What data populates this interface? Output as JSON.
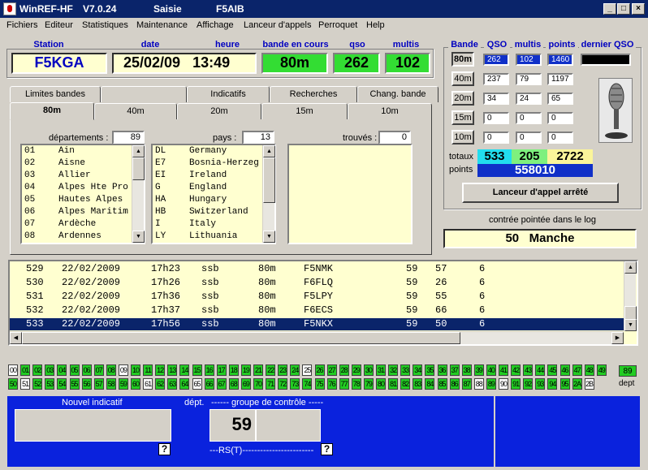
{
  "titlebar": {
    "app": "WinREF-HF",
    "version": "V7.0.24",
    "mode": "Saisie",
    "callsign": "F5AIB"
  },
  "menu": [
    "Fichiers",
    "Editeur",
    "Statistiques",
    "Maintenance",
    "Affichage",
    "Lanceur d'appels",
    "Perroquet",
    "Help"
  ],
  "header": {
    "station_label": "Station",
    "date_label": "date",
    "heure_label": "heure",
    "band_label": "bande en cours",
    "qso_label": "qso",
    "multis_label": "multis",
    "station": "F5KGA",
    "date": "25/02/09",
    "heure": "13:49",
    "band": "80m",
    "qso": "262",
    "multis": "102"
  },
  "bandtable": {
    "headers": [
      "Bande",
      "QSO",
      "multis",
      "points",
      "dernier QSO"
    ],
    "rows": [
      {
        "band": "80m",
        "qso": "262",
        "multis": "102",
        "points": "1460",
        "active": true
      },
      {
        "band": "40m",
        "qso": "237",
        "multis": "79",
        "points": "1197"
      },
      {
        "band": "20m",
        "qso": "34",
        "multis": "24",
        "points": "65"
      },
      {
        "band": "15m",
        "qso": "0",
        "multis": "0",
        "points": "0"
      },
      {
        "band": "10m",
        "qso": "0",
        "multis": "0",
        "points": "0"
      }
    ],
    "totaux_label": "totaux",
    "points_label": "points",
    "tot_qso": "533",
    "tot_multis": "205",
    "tot_points": "2722",
    "points_total": "558010"
  },
  "lanceur_button": "Lanceur d'appel arrêté",
  "contree": {
    "label": "contrée pointée dans le log",
    "value": "50",
    "name": "Manche"
  },
  "tabs_top": [
    "Limites bandes",
    "Indicatifs",
    "Recherches",
    "Chang. bande"
  ],
  "tabs_bottom": [
    "80m",
    "40m",
    "20m",
    "15m",
    "10m"
  ],
  "lists": {
    "dept_label": "départements :",
    "dept_count": "89",
    "pays_label": "pays :",
    "pays_count": "13",
    "trouves_label": "trouvés :",
    "trouves_count": "0",
    "departements": [
      [
        "01",
        "Ain"
      ],
      [
        "02",
        "Aisne"
      ],
      [
        "03",
        "Allier"
      ],
      [
        "04",
        "Alpes Hte Pro"
      ],
      [
        "05",
        "Hautes Alpes"
      ],
      [
        "06",
        "Alpes Maritim"
      ],
      [
        "07",
        "Ardèche"
      ],
      [
        "08",
        "Ardennes"
      ]
    ],
    "pays": [
      [
        "DL",
        "Germany"
      ],
      [
        "E7",
        "Bosnia-Herzeg"
      ],
      [
        "EI",
        "Ireland"
      ],
      [
        "G",
        "England"
      ],
      [
        "HA",
        "Hungary"
      ],
      [
        "HB",
        "Switzerland"
      ],
      [
        "I",
        "Italy"
      ],
      [
        "LY",
        "Lithuania"
      ]
    ]
  },
  "log": [
    [
      "529",
      "22/02/2009",
      "17h23",
      "ssb",
      "80m",
      "F5NMK",
      "59",
      "57",
      "6"
    ],
    [
      "530",
      "22/02/2009",
      "17h26",
      "ssb",
      "80m",
      "F6FLQ",
      "59",
      "26",
      "6"
    ],
    [
      "531",
      "22/02/2009",
      "17h36",
      "ssb",
      "80m",
      "F5LPY",
      "59",
      "55",
      "6"
    ],
    [
      "532",
      "22/02/2009",
      "17h37",
      "ssb",
      "80m",
      "F6ECS",
      "59",
      "66",
      "6"
    ],
    [
      "533",
      "22/02/2009",
      "17h56",
      "ssb",
      "80m",
      "F5NKX",
      "59",
      "50",
      "6"
    ]
  ],
  "dept_grid": {
    "white": [
      "00",
      "09",
      "25",
      "51",
      "61",
      "65",
      "88",
      "90",
      "2B"
    ],
    "row1": [
      "00",
      "01",
      "02",
      "03",
      "04",
      "05",
      "06",
      "07",
      "08",
      "09",
      "10",
      "11",
      "12",
      "13",
      "14",
      "15",
      "16",
      "17",
      "18",
      "19",
      "21",
      "22",
      "23",
      "24",
      "25",
      "26",
      "27",
      "28",
      "29",
      "30",
      "31",
      "32",
      "33",
      "34",
      "35",
      "36",
      "37",
      "38",
      "39",
      "40",
      "41",
      "42",
      "43",
      "44",
      "45",
      "46",
      "47",
      "48",
      "49"
    ],
    "row2": [
      "50",
      "51",
      "52",
      "53",
      "54",
      "55",
      "56",
      "57",
      "58",
      "59",
      "60",
      "61",
      "62",
      "63",
      "64",
      "65",
      "66",
      "67",
      "68",
      "69",
      "70",
      "71",
      "72",
      "73",
      "74",
      "75",
      "76",
      "77",
      "78",
      "79",
      "80",
      "81",
      "82",
      "83",
      "84",
      "85",
      "86",
      "87",
      "88",
      "89",
      "90",
      "91",
      "92",
      "93",
      "94",
      "95",
      "2A",
      "2B"
    ],
    "count": "89",
    "count_label": "dept"
  },
  "entry": {
    "nouvel_label": "Nouvel indicatif",
    "dept_label": "dépt.",
    "groupe_label": "------ groupe de contrôle -----",
    "rst_label": "---RS(T)------------------------",
    "rst_value": "59",
    "qmark": "?"
  }
}
